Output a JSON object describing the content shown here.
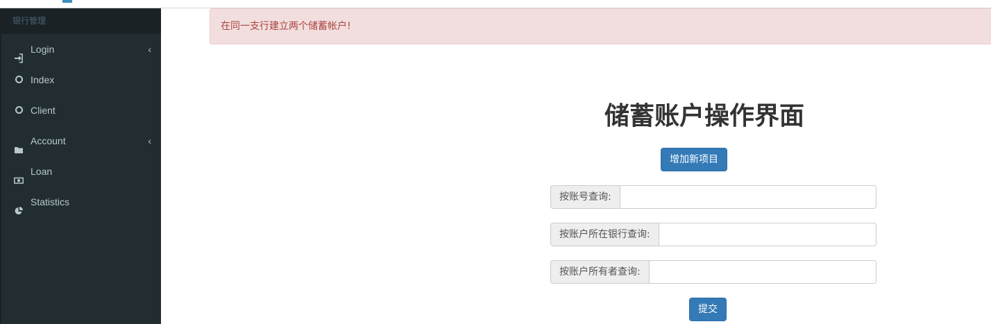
{
  "sidebar": {
    "header": "银行管理",
    "items": [
      {
        "label": "Login",
        "icon": "sign-in-icon",
        "has_chevron": true
      },
      {
        "label": "Index",
        "icon": "circle-icon",
        "has_chevron": false
      },
      {
        "label": "Client",
        "icon": "circle-icon",
        "has_chevron": false
      },
      {
        "label": "Account",
        "icon": "folder-icon",
        "has_chevron": true
      },
      {
        "label": "Loan",
        "icon": "money-icon",
        "has_chevron": false
      },
      {
        "label": "Statistics",
        "icon": "pie-chart-icon",
        "has_chevron": false
      }
    ],
    "chevron": "‹"
  },
  "alert": {
    "message": "在同一支行建立两个储蓄帐户!"
  },
  "main": {
    "title": "储蓄账户操作界面",
    "add_button": "增加新项目",
    "search_fields": [
      {
        "label": "按账号查询:",
        "value": ""
      },
      {
        "label": "按账户所在银行查询:",
        "value": ""
      },
      {
        "label": "按账户所有者查询:",
        "value": ""
      }
    ],
    "submit_button": "提交"
  },
  "colors": {
    "sidebar_bg": "#222d32",
    "sidebar_text": "#b8c7ce",
    "alert_bg": "#f2dede",
    "alert_text": "#a94442",
    "primary": "#337ab7"
  }
}
